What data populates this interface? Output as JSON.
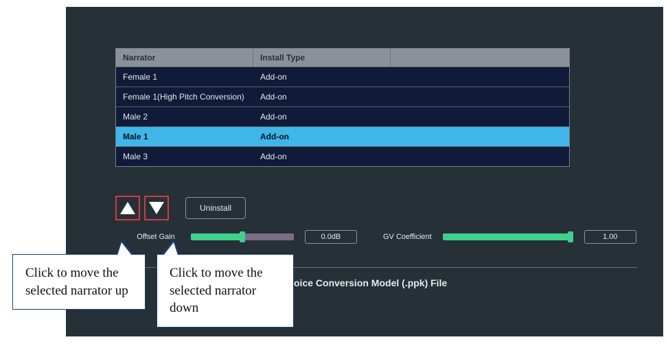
{
  "table": {
    "headers": {
      "narrator": "Narrator",
      "install": "Install Type"
    },
    "rows": [
      {
        "narrator": "Female 1",
        "install": "Add-on",
        "selected": false
      },
      {
        "narrator": "Female 1(High Pitch Conversion)",
        "install": "Add-on",
        "selected": false
      },
      {
        "narrator": "Male 2",
        "install": "Add-on",
        "selected": false
      },
      {
        "narrator": "Male 1",
        "install": "Add-on",
        "selected": true
      },
      {
        "narrator": "Male 3",
        "install": "Add-on",
        "selected": false
      }
    ]
  },
  "buttons": {
    "uninstall": "Uninstall"
  },
  "sliders": {
    "offset_label": "Offset Gain",
    "offset_value": "0.0dB",
    "gv_label": "GV Coefficient",
    "gv_value": "1.00"
  },
  "section": {
    "voice_model": "oice Conversion Model (.ppk) File"
  },
  "callouts": {
    "up": "Click to move the selected narrator up",
    "down": "Click to move the selected narrator down"
  },
  "colors": {
    "panel_bg": "#263037",
    "row_bg": "#0f1b38",
    "selected_bg": "#3fb6e8",
    "highlight_border": "#d23b3b",
    "slider_green": "#3fd08c",
    "callout_border": "#1a3c8a"
  }
}
